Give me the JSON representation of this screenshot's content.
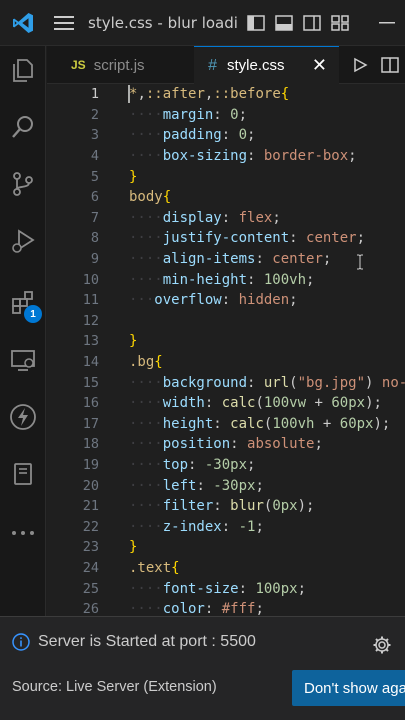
{
  "window": {
    "title": "style.css - blur loadin..."
  },
  "tabs": [
    {
      "icon": "JS",
      "label": "script.js"
    },
    {
      "icon": "#",
      "label": "style.css",
      "close": "✕"
    }
  ],
  "activity": {
    "extensions_badge": "1"
  },
  "editor": {
    "lines": [
      {
        "n": "1",
        "tokens": [
          [
            "t-sel",
            "*"
          ],
          [
            "t-punc",
            ","
          ],
          [
            "t-sel",
            "::after"
          ],
          [
            "t-punc",
            ","
          ],
          [
            "t-sel",
            "::before"
          ],
          [
            "t-br",
            "{"
          ]
        ]
      },
      {
        "n": "2",
        "tokens": [
          [
            "ws",
            "····"
          ],
          [
            "t-prop",
            "margin"
          ],
          [
            "t-punc",
            ": "
          ],
          [
            "t-num",
            "0"
          ],
          [
            "t-punc",
            ";"
          ]
        ]
      },
      {
        "n": "3",
        "tokens": [
          [
            "ws",
            "····"
          ],
          [
            "t-prop",
            "padding"
          ],
          [
            "t-punc",
            ": "
          ],
          [
            "t-num",
            "0"
          ],
          [
            "t-punc",
            ";"
          ]
        ]
      },
      {
        "n": "4",
        "tokens": [
          [
            "ws",
            "····"
          ],
          [
            "t-prop",
            "box-sizing"
          ],
          [
            "t-punc",
            ": "
          ],
          [
            "t-val",
            "border-box"
          ],
          [
            "t-punc",
            ";"
          ]
        ]
      },
      {
        "n": "5",
        "tokens": [
          [
            "t-br",
            "}"
          ]
        ]
      },
      {
        "n": "6",
        "tokens": [
          [
            "t-sel",
            "body"
          ],
          [
            "t-br",
            "{"
          ]
        ]
      },
      {
        "n": "7",
        "tokens": [
          [
            "ws",
            "····"
          ],
          [
            "t-prop",
            "display"
          ],
          [
            "t-punc",
            ": "
          ],
          [
            "t-val",
            "flex"
          ],
          [
            "t-punc",
            ";"
          ]
        ]
      },
      {
        "n": "8",
        "tokens": [
          [
            "ws",
            "····"
          ],
          [
            "t-prop",
            "justify-content"
          ],
          [
            "t-punc",
            ": "
          ],
          [
            "t-val",
            "center"
          ],
          [
            "t-punc",
            ";"
          ]
        ]
      },
      {
        "n": "9",
        "tokens": [
          [
            "ws",
            "····"
          ],
          [
            "t-prop",
            "align-items"
          ],
          [
            "t-punc",
            ": "
          ],
          [
            "t-val",
            "center"
          ],
          [
            "t-punc",
            ";"
          ]
        ]
      },
      {
        "n": "10",
        "tokens": [
          [
            "ws",
            "····"
          ],
          [
            "t-prop",
            "min-height"
          ],
          [
            "t-punc",
            ": "
          ],
          [
            "t-num",
            "100vh"
          ],
          [
            "t-punc",
            ";"
          ]
        ]
      },
      {
        "n": "11",
        "tokens": [
          [
            "ws",
            "···"
          ],
          [
            "t-prop",
            "overflow"
          ],
          [
            "t-punc",
            ": "
          ],
          [
            "t-val",
            "hidden"
          ],
          [
            "t-punc",
            ";"
          ]
        ]
      },
      {
        "n": "12",
        "tokens": []
      },
      {
        "n": "13",
        "tokens": [
          [
            "t-br",
            "}"
          ]
        ]
      },
      {
        "n": "14",
        "tokens": [
          [
            "t-sel",
            ".bg"
          ],
          [
            "t-br",
            "{"
          ]
        ]
      },
      {
        "n": "15",
        "tokens": [
          [
            "ws",
            "····"
          ],
          [
            "t-prop",
            "background"
          ],
          [
            "t-punc",
            ": "
          ],
          [
            "t-fn",
            "url"
          ],
          [
            "t-punc",
            "("
          ],
          [
            "t-val",
            "\"bg.jpg\""
          ],
          [
            "t-punc",
            ") "
          ],
          [
            "t-val",
            "no-"
          ]
        ]
      },
      {
        "n": "16",
        "tokens": [
          [
            "ws",
            "····"
          ],
          [
            "t-prop",
            "width"
          ],
          [
            "t-punc",
            ": "
          ],
          [
            "t-fn",
            "calc"
          ],
          [
            "t-punc",
            "("
          ],
          [
            "t-num",
            "100vw"
          ],
          [
            "t-punc",
            " + "
          ],
          [
            "t-num",
            "60px"
          ],
          [
            "t-punc",
            ");"
          ]
        ]
      },
      {
        "n": "17",
        "tokens": [
          [
            "ws",
            "····"
          ],
          [
            "t-prop",
            "height"
          ],
          [
            "t-punc",
            ": "
          ],
          [
            "t-fn",
            "calc"
          ],
          [
            "t-punc",
            "("
          ],
          [
            "t-num",
            "100vh"
          ],
          [
            "t-punc",
            " + "
          ],
          [
            "t-num",
            "60px"
          ],
          [
            "t-punc",
            ");"
          ]
        ]
      },
      {
        "n": "18",
        "tokens": [
          [
            "ws",
            "····"
          ],
          [
            "t-prop",
            "position"
          ],
          [
            "t-punc",
            ": "
          ],
          [
            "t-val",
            "absolute"
          ],
          [
            "t-punc",
            ";"
          ]
        ]
      },
      {
        "n": "19",
        "tokens": [
          [
            "ws",
            "····"
          ],
          [
            "t-prop",
            "top"
          ],
          [
            "t-punc",
            ": "
          ],
          [
            "t-num",
            "-30px"
          ],
          [
            "t-punc",
            ";"
          ]
        ]
      },
      {
        "n": "20",
        "tokens": [
          [
            "ws",
            "····"
          ],
          [
            "t-prop",
            "left"
          ],
          [
            "t-punc",
            ": "
          ],
          [
            "t-num",
            "-30px"
          ],
          [
            "t-punc",
            ";"
          ]
        ]
      },
      {
        "n": "21",
        "tokens": [
          [
            "ws",
            "····"
          ],
          [
            "t-prop",
            "filter"
          ],
          [
            "t-punc",
            ": "
          ],
          [
            "t-fn",
            "blur"
          ],
          [
            "t-punc",
            "("
          ],
          [
            "t-num",
            "0px"
          ],
          [
            "t-punc",
            ");"
          ]
        ]
      },
      {
        "n": "22",
        "tokens": [
          [
            "ws",
            "····"
          ],
          [
            "t-prop",
            "z-index"
          ],
          [
            "t-punc",
            ": "
          ],
          [
            "t-num",
            "-1"
          ],
          [
            "t-punc",
            ";"
          ]
        ]
      },
      {
        "n": "23",
        "tokens": [
          [
            "t-br",
            "}"
          ]
        ]
      },
      {
        "n": "24",
        "tokens": [
          [
            "t-sel",
            ".text"
          ],
          [
            "t-br",
            "{"
          ]
        ]
      },
      {
        "n": "25",
        "tokens": [
          [
            "ws",
            "····"
          ],
          [
            "t-prop",
            "font-size"
          ],
          [
            "t-punc",
            ": "
          ],
          [
            "t-num",
            "100px"
          ],
          [
            "t-punc",
            ";"
          ]
        ]
      },
      {
        "n": "26",
        "tokens": [
          [
            "ws",
            "····"
          ],
          [
            "t-prop",
            "color"
          ],
          [
            "t-punc",
            ": "
          ],
          [
            "t-val",
            "#fff"
          ],
          [
            "t-punc",
            ";"
          ]
        ]
      }
    ]
  },
  "notification": {
    "message": "Server is Started at port : 5500",
    "source": "Source: Live Server (Extension)",
    "button": "Don't show aga"
  },
  "colors": {
    "accent": "#0078d4",
    "button": "#0e639c"
  }
}
